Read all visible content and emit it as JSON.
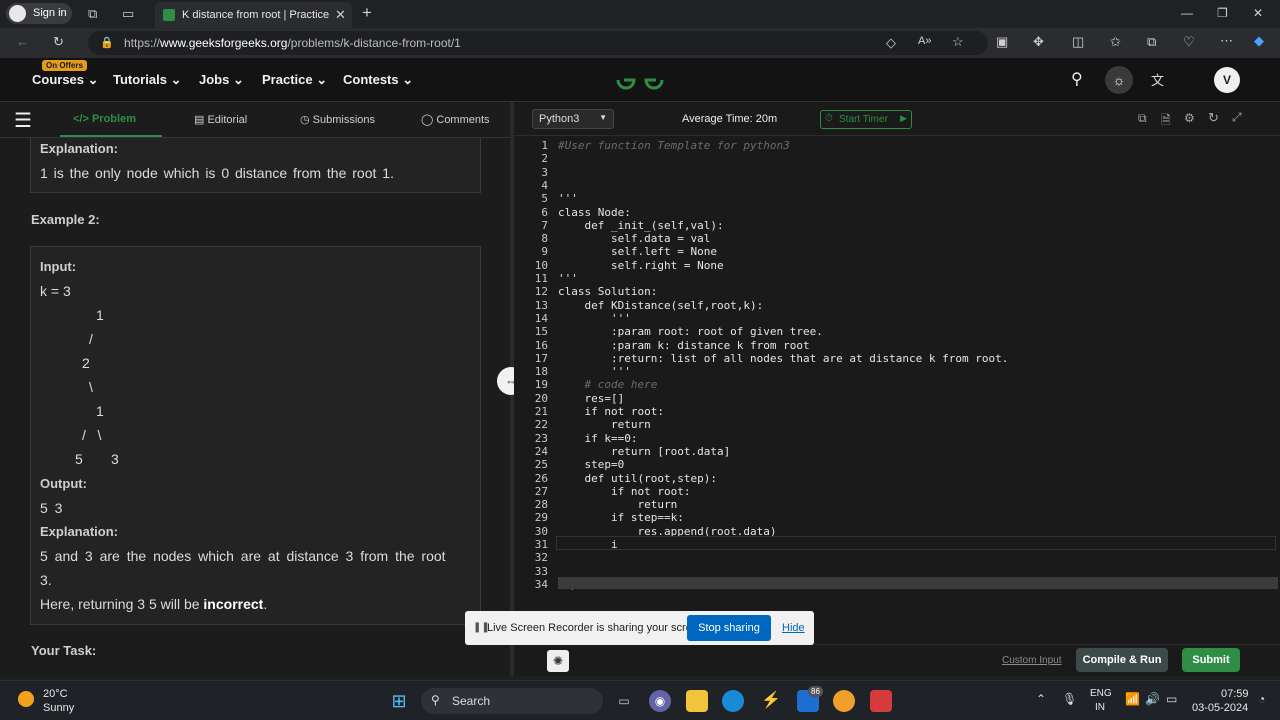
{
  "browser": {
    "sign_in": "Sign in",
    "tab_title": "K distance from root | Practice | ",
    "url_prefix": "https://",
    "url_host": "www.geeksforgeeks.org",
    "url_path": "/problems/k-distance-from-root/1"
  },
  "nav": {
    "offers_badge": "On Offers",
    "items": [
      "Courses",
      "Tutorials",
      "Jobs",
      "Practice",
      "Contests"
    ],
    "avatar_letter": "V"
  },
  "left_tabs": [
    "Problem",
    "Editorial",
    "Submissions",
    "Comments"
  ],
  "problem": {
    "explanation_label": "Explanation:",
    "explanation1": "1 is the only node which is 0 distance from the root 1.",
    "example2_label": "Example 2:",
    "input_label": "Input:",
    "k_line": "k = 3",
    "tree_lines": [
      "1",
      "/",
      "2",
      "\\",
      "1",
      "/   \\",
      "5",
      "3"
    ],
    "output_label": "Output:",
    "output_value": "5 3",
    "explanation2_label": "Explanation:",
    "explanation2_a": "5 and 3 are the nodes which are at distance 3 from the root",
    "explanation2_b": "3.",
    "here_text": "Here, returning 3 5 will be ",
    "incorrect": "incorrect",
    "here_period": ".",
    "your_task": "Your Task:"
  },
  "editor": {
    "language": "Python3",
    "avg_time": "Average Time: 20m",
    "start_timer": "Start Timer",
    "lines": [
      {
        "n": "1",
        "t": "#User function Template for python3",
        "c": true
      },
      {
        "n": "2",
        "t": ""
      },
      {
        "n": "3",
        "t": ""
      },
      {
        "n": "4",
        "t": ""
      },
      {
        "n": "5",
        "t": "'''"
      },
      {
        "n": "6",
        "t": "class Node:"
      },
      {
        "n": "7",
        "t": "    def _init_(self,val):"
      },
      {
        "n": "8",
        "t": "        self.data = val"
      },
      {
        "n": "9",
        "t": "        self.left = None"
      },
      {
        "n": "10",
        "t": "        self.right = None"
      },
      {
        "n": "11",
        "t": "'''"
      },
      {
        "n": "12",
        "t": "class Solution:"
      },
      {
        "n": "13",
        "t": "    def KDistance(self,root,k):"
      },
      {
        "n": "14",
        "t": "        '''"
      },
      {
        "n": "15",
        "t": "        :param root: root of given tree."
      },
      {
        "n": "16",
        "t": "        :param k: distance k from root"
      },
      {
        "n": "17",
        "t": "        :return: list of all nodes that are at distance k from root."
      },
      {
        "n": "18",
        "t": "        '''"
      },
      {
        "n": "19",
        "t": "    # code here",
        "c": true
      },
      {
        "n": "20",
        "t": "    res=[]"
      },
      {
        "n": "21",
        "t": "    if not root:"
      },
      {
        "n": "22",
        "t": "        return"
      },
      {
        "n": "23",
        "t": "    if k==0:"
      },
      {
        "n": "24",
        "t": "        return [root.data]"
      },
      {
        "n": "25",
        "t": "    step=0"
      },
      {
        "n": "26",
        "t": "    def util(root,step):"
      },
      {
        "n": "27",
        "t": "        if not root:"
      },
      {
        "n": "28",
        "t": "            return"
      },
      {
        "n": "29",
        "t": "        if step==k:"
      },
      {
        "n": "30",
        "t": "            res.append(root.data)"
      },
      {
        "n": "31",
        "t": "        i"
      },
      {
        "n": "32",
        "t": ""
      },
      {
        "n": "33",
        "t": ""
      },
      {
        "n": "34",
        "t": "# } Driver Code Ends",
        "c": true
      }
    ],
    "custom_input": "Custom Input",
    "compile_run": "Compile & Run",
    "submit": "Submit"
  },
  "share_banner": {
    "text": "Live Screen Recorder is sharing your screen.",
    "stop": "Stop sharing",
    "hide": "Hide"
  },
  "taskbar": {
    "temp": "20°C",
    "weather": "Sunny",
    "search": "Search",
    "badge": "86",
    "lang1": "ENG",
    "lang2": "IN",
    "time": "07:59",
    "date": "03-05-2024"
  },
  "colors": {
    "gfg_green": "#2f8d46",
    "accent_blue": "#0067c0"
  }
}
